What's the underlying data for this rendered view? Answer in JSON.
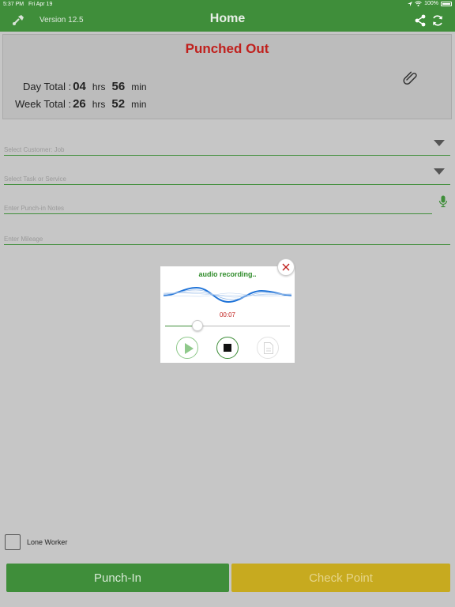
{
  "status_bar": {
    "time": "5:37 PM",
    "date": "Fri Apr 19",
    "battery": "100%"
  },
  "nav": {
    "version": "Version 12.5",
    "title": "Home",
    "logo_icon": "tool-icon",
    "share_icon": "share-icon",
    "refresh_icon": "refresh-icon"
  },
  "summary": {
    "status": "Punched Out",
    "attach_icon": "paperclip-icon",
    "day": {
      "label": "Day Total :",
      "hours": "04",
      "hrs_unit": "hrs",
      "minutes": "56",
      "min_unit": "min"
    },
    "week": {
      "label": "Week Total :",
      "hours": "26",
      "hrs_unit": "hrs",
      "minutes": "52",
      "min_unit": "min"
    }
  },
  "form": {
    "customer_placeholder": "Select Customer: Job",
    "task_placeholder": "Select Task or Service",
    "notes_placeholder": "Enter Punch-in Notes",
    "mileage_placeholder": "Enter Mileage"
  },
  "audio_popup": {
    "title": "audio recording..",
    "elapsed": "00:07",
    "progress": 0.26
  },
  "lone_worker": {
    "label": "Lone Worker",
    "checked": false
  },
  "actions": {
    "punch_in": "Punch-In",
    "check_point": "Check Point"
  },
  "colors": {
    "brand_green": "#3f8e3a",
    "status_red": "#c0201d",
    "checkpoint_yellow": "#c7aa1f"
  }
}
